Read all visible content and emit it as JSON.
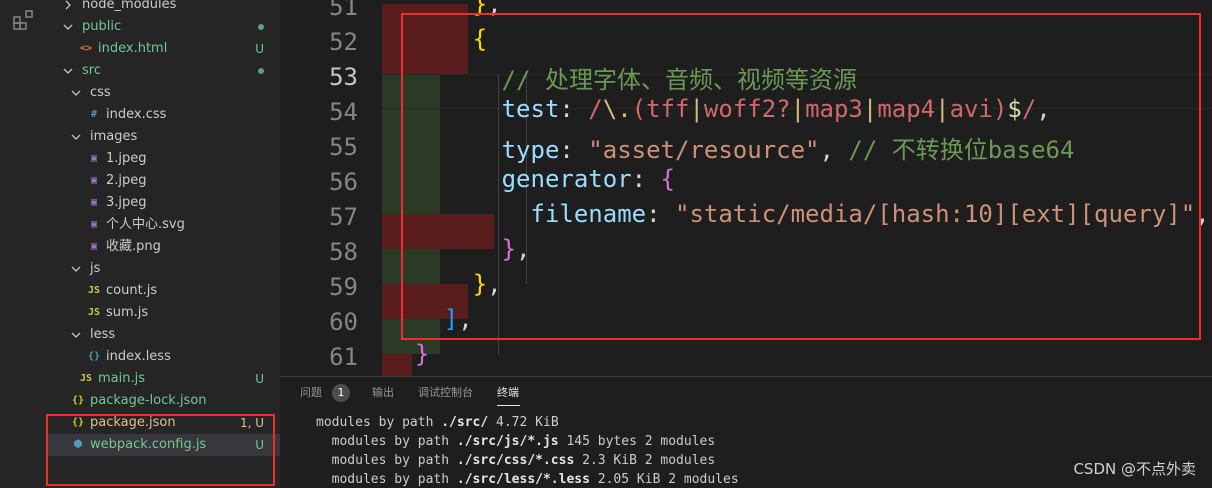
{
  "explorer": {
    "items": [
      {
        "label": "node_modules",
        "badge": "",
        "kind": "folder-collapsed",
        "depth": 0,
        "color": "#cccccc",
        "icon": ""
      },
      {
        "label": "public",
        "badge": "",
        "kind": "folder-open",
        "depth": 0,
        "color": "#73c991",
        "icon": "",
        "dot": true
      },
      {
        "label": "index.html",
        "badge": "U",
        "kind": "file",
        "depth": 1,
        "color": "#73c991",
        "icon": "html-icon"
      },
      {
        "label": "src",
        "badge": "",
        "kind": "folder-open",
        "depth": 0,
        "color": "#73c991",
        "icon": "",
        "dot": true
      },
      {
        "label": "css",
        "badge": "",
        "kind": "folder-open",
        "depth": 1,
        "color": "#cccccc",
        "icon": ""
      },
      {
        "label": "index.css",
        "badge": "",
        "kind": "file",
        "depth": 2,
        "color": "#cccccc",
        "icon": "css-icon"
      },
      {
        "label": "images",
        "badge": "",
        "kind": "folder-open",
        "depth": 1,
        "color": "#cccccc",
        "icon": ""
      },
      {
        "label": "1.jpeg",
        "badge": "",
        "kind": "file",
        "depth": 2,
        "color": "#cccccc",
        "icon": "image-icon"
      },
      {
        "label": "2.jpeg",
        "badge": "",
        "kind": "file",
        "depth": 2,
        "color": "#cccccc",
        "icon": "image-icon"
      },
      {
        "label": "3.jpeg",
        "badge": "",
        "kind": "file",
        "depth": 2,
        "color": "#cccccc",
        "icon": "image-icon"
      },
      {
        "label": "个人中心.svg",
        "badge": "",
        "kind": "file",
        "depth": 2,
        "color": "#cccccc",
        "icon": "svg-icon"
      },
      {
        "label": "收藏.png",
        "badge": "",
        "kind": "file",
        "depth": 2,
        "color": "#cccccc",
        "icon": "image-icon"
      },
      {
        "label": "js",
        "badge": "",
        "kind": "folder-open",
        "depth": 1,
        "color": "#cccccc",
        "icon": ""
      },
      {
        "label": "count.js",
        "badge": "",
        "kind": "file",
        "depth": 2,
        "color": "#cccccc",
        "icon": "js-icon"
      },
      {
        "label": "sum.js",
        "badge": "",
        "kind": "file",
        "depth": 2,
        "color": "#cccccc",
        "icon": "js-icon"
      },
      {
        "label": "less",
        "badge": "",
        "kind": "folder-open",
        "depth": 1,
        "color": "#cccccc",
        "icon": ""
      },
      {
        "label": "index.less",
        "badge": "",
        "kind": "file",
        "depth": 2,
        "color": "#cccccc",
        "icon": "less-icon"
      },
      {
        "label": "main.js",
        "badge": "U",
        "kind": "file",
        "depth": 1,
        "color": "#73c991",
        "icon": "js-icon"
      },
      {
        "label": "package-lock.json",
        "badge": "",
        "kind": "file",
        "depth": 0,
        "color": "#73c991",
        "icon": "json-icon"
      },
      {
        "label": "package.json",
        "badge": "1, U",
        "kind": "file",
        "depth": 0,
        "color": "#e2c08d",
        "icon": "json-icon"
      },
      {
        "label": "webpack.config.js",
        "badge": "U",
        "kind": "file",
        "depth": 0,
        "color": "#73c991",
        "icon": "webpack-icon",
        "selected": true
      }
    ]
  },
  "editor": {
    "line_numbers": [
      "51",
      "52",
      "53",
      "54",
      "55",
      "56",
      "57",
      "58",
      "59",
      "60",
      "61"
    ],
    "active_line": "53",
    "code": {
      "l51": {
        "brace": "}",
        "comma": ","
      },
      "l52": {
        "brace": "{"
      },
      "l53": {
        "comment": "// 处理字体、音频、视频等资源"
      },
      "l54": {
        "key": "test",
        "colon": ": ",
        "re_open": "/",
        "re_esc": "\\.",
        "re_paren_open": "(",
        "alt1": "tff",
        "pipe1": "|",
        "alt2": "woff2?",
        "pipe2": "|",
        "alt3": "map3",
        "pipe3": "|",
        "alt4": "map4",
        "pipe4": "|",
        "alt5": "avi",
        "re_paren_close": ")",
        "dollar": "$",
        "re_close": "/",
        "comma": ","
      },
      "l55": {
        "key": "type",
        "colon": ": ",
        "value": "\"asset/resource\"",
        "comma": ", ",
        "comment": "// 不转换位base64"
      },
      "l56": {
        "key": "generator",
        "colon": ": ",
        "brace": "{"
      },
      "l57": {
        "key": "filename",
        "colon": ": ",
        "value": "\"static/media/[hash:10][ext][query]\"",
        "comma": ","
      },
      "l58": {
        "brace": "}",
        "comma": ","
      },
      "l59": {
        "brace": "}",
        "comma": ","
      },
      "l60": {
        "bracket": "]",
        "comma": ","
      },
      "l61": {
        "brace": "}"
      }
    }
  },
  "panel": {
    "tabs": [
      {
        "label": "问题",
        "active": false
      },
      {
        "label": "输出",
        "active": false
      },
      {
        "label": "调试控制台",
        "active": false
      },
      {
        "label": "终端",
        "active": true
      }
    ],
    "problems_count": "1",
    "terminal": [
      {
        "pre": "modules by path ",
        "path": "./src/",
        "post": " 4.72 KiB"
      },
      {
        "pre": "  modules by path ",
        "path": "./src/js/*.js",
        "post": " 145 bytes 2 modules"
      },
      {
        "pre": "  modules by path ",
        "path": "./src/css/*.css",
        "post": " 2.3 KiB 2 modules"
      },
      {
        "pre": "  modules by path ",
        "path": "./src/less/*.less",
        "post": " 2.05 KiB 2 modules"
      }
    ]
  },
  "watermark": "CSDN @不点外卖",
  "colors": {
    "annotation_red": "#f22b2b",
    "git_untracked": "#73c991",
    "git_modified": "#e2c08d",
    "diff_removed": "#5a1d1d",
    "diff_added": "#2b3a26"
  }
}
